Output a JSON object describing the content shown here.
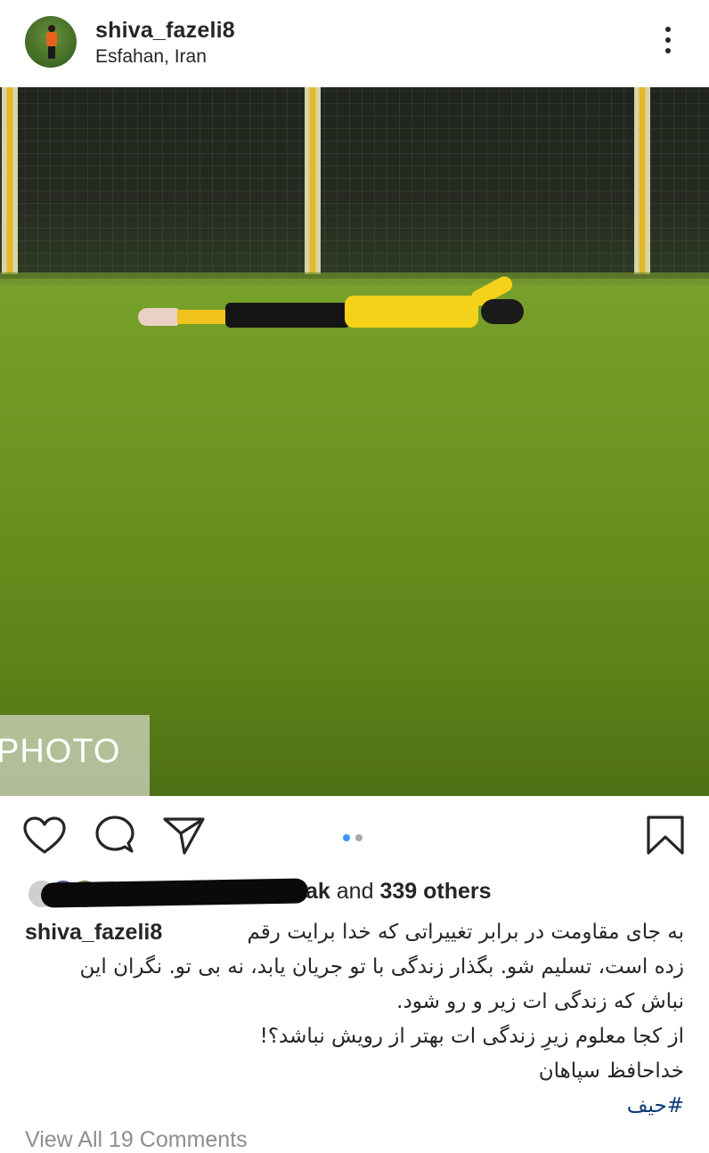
{
  "header": {
    "username": "shiva_fazeli8",
    "location": "Esfahan, Iran",
    "more_icon": "vertical-ellipsis-icon"
  },
  "photo": {
    "watermark": "PHOTO",
    "carousel_count": 2,
    "carousel_active_index": 0
  },
  "actions": {
    "like_icon": "heart-icon",
    "comment_icon": "comment-bubble-icon",
    "share_icon": "paper-plane-icon",
    "save_icon": "bookmark-icon"
  },
  "likes": {
    "partial_name": "ak",
    "conjunction": "and",
    "others": "339 others"
  },
  "caption": {
    "username": "shiva_fazeli8",
    "lines": [
      "به جای مقاومت در برابر تغییراتی که خدا برایت رقم",
      "زده است، تسلیم شو. بگذار زندگی با تو جریان یابد، نه بی تو. نگران این",
      "نباش که زندگی ات زیر و رو شود.",
      "از کجا معلوم زیرِ زندگی ات بهتر از رویش نباشد؟!",
      "خداحافظ سپاهان",
      "#حیف"
    ]
  },
  "comments": {
    "view_all": "View All 19 Comments"
  },
  "colors": {
    "text": "#262626",
    "carousel_active": "#3897f0",
    "carousel_inactive": "#a8a8a8",
    "hashtag": "#0b3b76"
  }
}
